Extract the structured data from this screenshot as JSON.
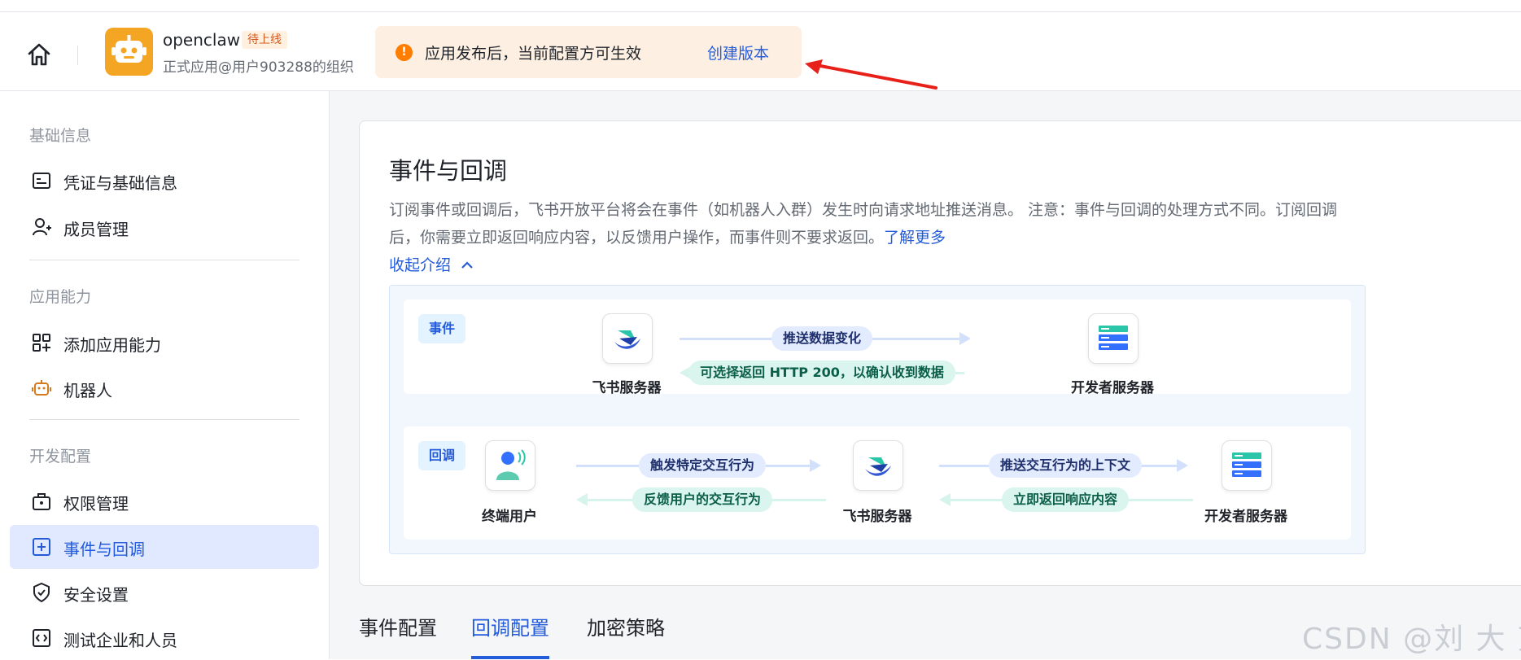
{
  "header": {
    "app_name": "openclaw",
    "app_status": "待上线",
    "app_subtitle": "正式应用@用户903288的组织",
    "notice_text": "应用发布后，当前配置方可生效",
    "notice_link": "创建版本",
    "icons": {
      "home": "home-icon",
      "logo": "robot-icon",
      "warn": "warning-icon"
    }
  },
  "sidebar": {
    "section_basic": "基础信息",
    "item_credentials": "凭证与基础信息",
    "item_members": "成员管理",
    "section_capability": "应用能力",
    "item_add_capability": "添加应用能力",
    "item_bot": "机器人",
    "section_dev": "开发配置",
    "item_permissions": "权限管理",
    "item_events": "事件与回调",
    "item_security": "安全设置",
    "item_test": "测试企业和人员"
  },
  "main": {
    "title": "事件与回调",
    "desc_text": "订阅事件或回调后，飞书开放平台将会在事件（如机器人入群）发生时向请求地址推送消息。 注意：事件与回调的处理方式不同。订阅回调后，你需要立即返回响应内容，以反馈用户操作，而事件则不要求返回。",
    "desc_link": "了解更多",
    "collapse_label": "收起介绍",
    "diagram": {
      "event_tag": "事件",
      "feishu_server": "飞书服务器",
      "dev_server": "开发者服务器",
      "event_push": "推送数据变化",
      "event_return": "可选择返回 HTTP 200，以确认收到数据",
      "callback_tag": "回调",
      "end_user": "终端用户",
      "cb_trigger": "触发特定交互行为",
      "cb_feedback": "反馈用户的交互行为",
      "cb_push_context": "推送交互行为的上下文",
      "cb_return": "立即返回响应内容"
    },
    "tabs": [
      "事件配置",
      "回调配置",
      "加密策略"
    ],
    "active_tab": "回调配置"
  },
  "watermark": "CSDN @刘 大 望",
  "colors": {
    "accent": "#245bdb",
    "notice_bg": "#fdf0e2",
    "warn": "#ff7d00",
    "active_bg": "#e0e9ff"
  }
}
